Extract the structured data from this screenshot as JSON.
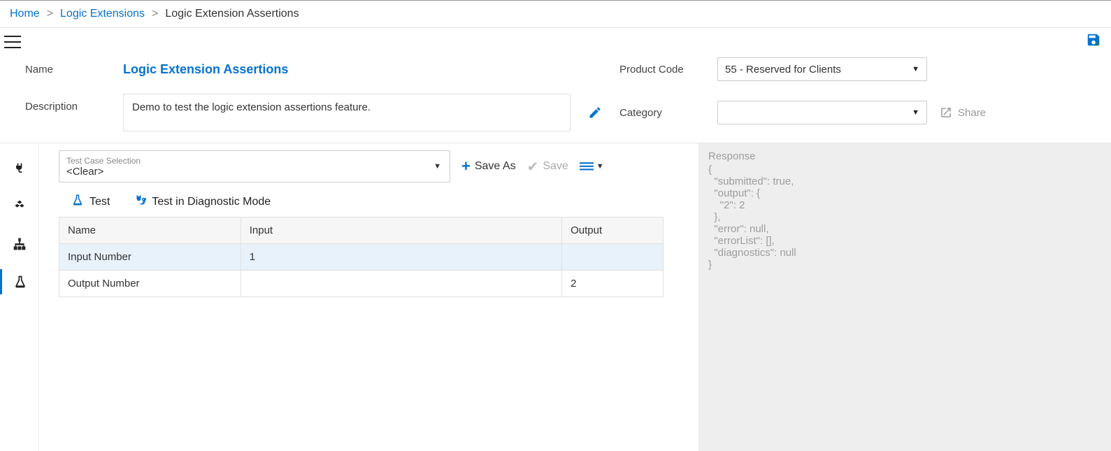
{
  "breadcrumb": {
    "home": "Home",
    "mid": "Logic Extensions",
    "current": "Logic Extension Assertions"
  },
  "form": {
    "name_label": "Name",
    "name_value": "Logic Extension Assertions",
    "desc_label": "Description",
    "desc_value": "Demo to test the logic extension assertions feature.",
    "product_label": "Product Code",
    "product_value": "55 - Reserved for Clients",
    "category_label": "Category",
    "category_value": "",
    "share_label": "Share"
  },
  "toolbar": {
    "tc_label": "Test Case Selection",
    "tc_value": "<Clear>",
    "save_as": "Save As",
    "save": "Save",
    "test": "Test",
    "test_diag": "Test in Diagnostic Mode"
  },
  "table": {
    "headers": {
      "name": "Name",
      "input": "Input",
      "output": "Output"
    },
    "rows": [
      {
        "name": "Input Number",
        "input": "1",
        "output": ""
      },
      {
        "name": "Output Number",
        "input": "",
        "output": "2"
      }
    ]
  },
  "response": {
    "header": "Response",
    "body": "{\n  \"submitted\": true,\n  \"output\": {\n    \"2\": 2\n  },\n  \"error\": null,\n  \"errorList\": [],\n  \"diagnostics\": null\n}"
  }
}
